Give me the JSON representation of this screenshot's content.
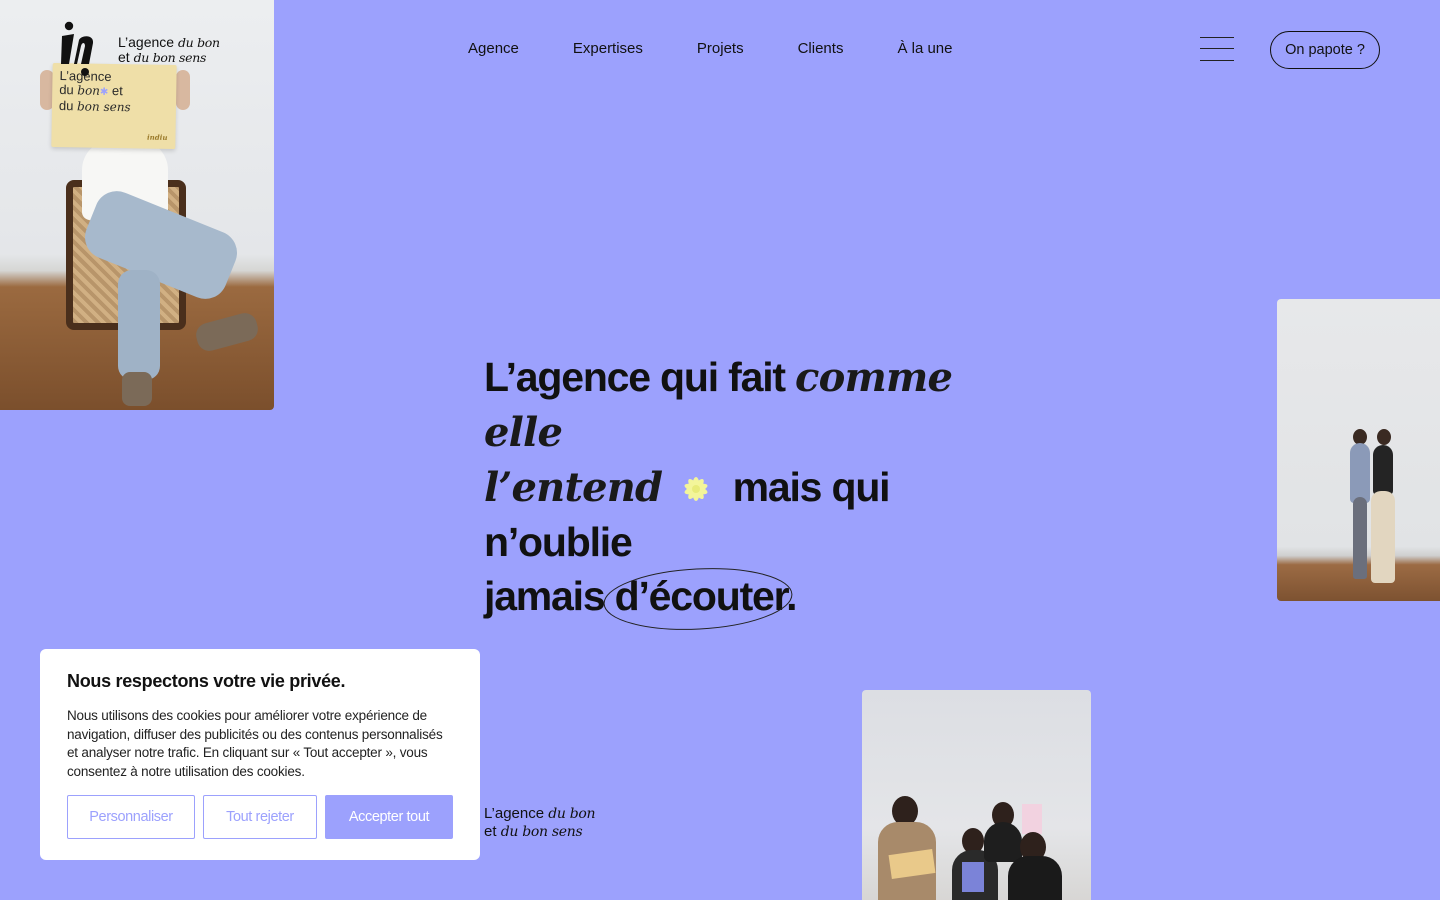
{
  "brand": {
    "logo_icon": "in-logo-icon",
    "tagline_line1_plain": "L’agence ",
    "tagline_line1_italic": "du bon",
    "tagline_line2_plain": "et ",
    "tagline_line2_italic": "du bon sens"
  },
  "nav": {
    "items": [
      {
        "label": "Agence"
      },
      {
        "label": "Expertises"
      },
      {
        "label": "Projets"
      },
      {
        "label": "Clients"
      },
      {
        "label": "À la une"
      }
    ],
    "menu_icon": "hamburger-menu-icon",
    "cta_label": "On papote ?"
  },
  "hero": {
    "part1": "L’agence qui fait ",
    "italic1": "comme elle",
    "italic2": "l’entend",
    "flower_icon": "flower-icon",
    "part2": " mais qui n’oublie",
    "part3": "jamais ",
    "circled": "d’écouter."
  },
  "photo_left": {
    "sign_line1": "L’agence",
    "sign_line2a": "du ",
    "sign_line2b": "bon",
    "sign_line2c": " et",
    "sign_line3a": "du ",
    "sign_line3b": "bon sens",
    "sign_brand": "indiu"
  },
  "footer_logo": {
    "line1_plain": "L’agence ",
    "line1_italic": "du bon",
    "line2_plain": "et ",
    "line2_italic": "du bon sens"
  },
  "cookie": {
    "title": "Nous respectons votre vie privée.",
    "text": "Nous utilisons des cookies pour améliorer votre expérience de navigation, diffuser des publicités ou des contenus personnalisés et analyser notre trafic. En cliquant sur « Tout accepter », vous consentez à notre utilisation des cookies.",
    "btn_personalize": "Personnaliser",
    "btn_reject": "Tout rejeter",
    "btn_accept": "Accepter tout"
  },
  "colors": {
    "background": "#9ca1fd",
    "accent": "#9ca1fd",
    "flower": "#f3f59a",
    "text": "#111111"
  }
}
